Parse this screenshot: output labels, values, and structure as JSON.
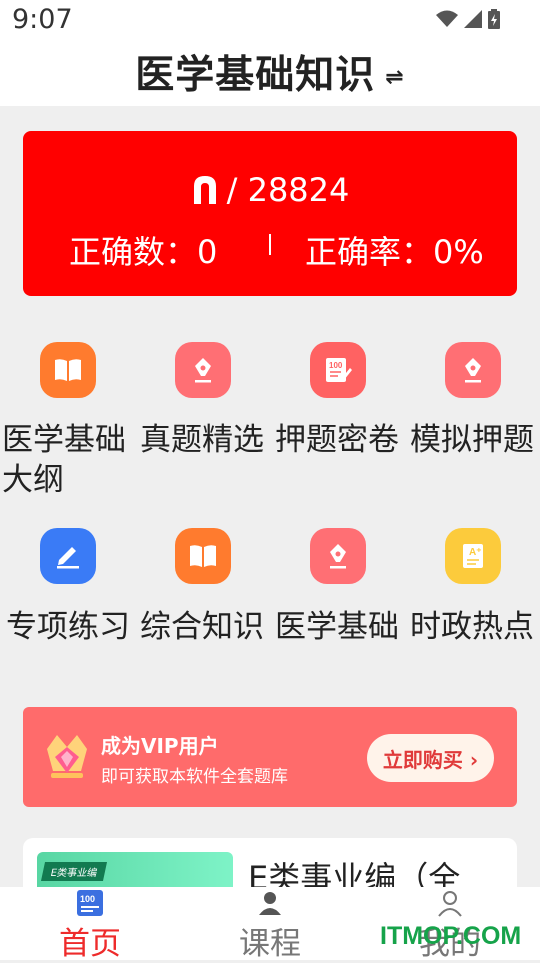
{
  "status_bar": {
    "time": "9:07"
  },
  "header": {
    "title": "医学基础知识",
    "swap_symbol": "⇌"
  },
  "stats": {
    "total_label": "/ 28824",
    "correct_count_label": "正确数：0",
    "correct_rate_label": "正确率：0%"
  },
  "grid": [
    {
      "label": "医学基础大纲",
      "icon": "book-icon",
      "color": "#ff7b2e"
    },
    {
      "label": "真题精选",
      "icon": "pen-icon",
      "color": "#ff6f74"
    },
    {
      "label": "押题密卷",
      "icon": "exam-paper-icon",
      "color": "#ff6262"
    },
    {
      "label": "模拟押题",
      "icon": "pen-icon",
      "color": "#ff6f74"
    },
    {
      "label": "专项练习",
      "icon": "edit-icon",
      "color": "#3a7bf6"
    },
    {
      "label": "综合知识",
      "icon": "book-icon",
      "color": "#ff7b2e"
    },
    {
      "label": "医学基础",
      "icon": "pen-icon",
      "color": "#ff6f74"
    },
    {
      "label": "时政热点",
      "icon": "grade-icon",
      "color": "#fccb3c"
    }
  ],
  "vip": {
    "title": "成为VIP用户",
    "subtitle": "即可获取本软件全套题库",
    "button": "立即购买 ›"
  },
  "course": {
    "tag": "E类事业编",
    "title": "E类事业编（全"
  },
  "nav": [
    {
      "label": "首页",
      "icon": "home-icon",
      "active": true
    },
    {
      "label": "课程",
      "icon": "course-icon",
      "active": false
    },
    {
      "label": "我的",
      "icon": "profile-icon",
      "active": false
    }
  ],
  "watermark": "ITMOP.COM",
  "colors": {
    "accent_red": "#ff0000",
    "vip_red": "#ff6b6b",
    "nav_active": "#ee2b2b"
  }
}
